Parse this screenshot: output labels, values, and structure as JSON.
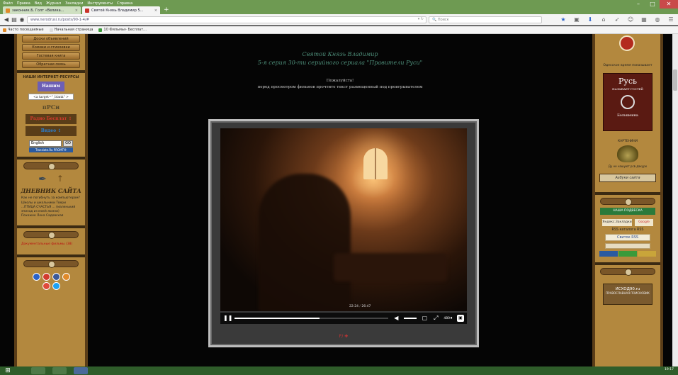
{
  "browser": {
    "menu": [
      "Файл",
      "Правка",
      "Вид",
      "Журнал",
      "Закладки",
      "Инструменты",
      "Справка"
    ],
    "tabs": [
      {
        "label": "законник.Б. Голт «Велика...",
        "favicon_color": "#e08a2a",
        "active": false
      },
      {
        "label": "Святой Князь Владимир 5...",
        "favicon_color": "#c9322a",
        "active": true
      }
    ],
    "new_tab_label": "+",
    "url": "www.nerodrusi.ru/posts/90-1-4/#",
    "search_placeholder": "Поиск",
    "bookmarks": [
      "Часто посещаемые",
      "Начальная страница",
      "10 Фильмы» Бесплат..."
    ],
    "window_controls": {
      "minimize": "–",
      "maximize": "□",
      "close": "✕"
    }
  },
  "left_sidebar": {
    "buttons": [
      "Доски объявлений",
      "Комики и стихоевки",
      "Гостевая книга",
      "Обратная связь"
    ],
    "resources_title": "НАШИ ИНТЕРНЕТ-РЕСУРСЫ",
    "logos": [
      {
        "text": "Нашим",
        "color": "#6d5fb5"
      },
      {
        "text": "<a target=\"_blank\" >",
        "color": "#ffffff"
      },
      {
        "text": "пРСи",
        "color": "#5a4a2a"
      },
      {
        "text": "Радио Бесплат ↕",
        "color": "#d23b2e"
      },
      {
        "text": "Видео ↕",
        "color": "#2b7fd0"
      }
    ],
    "translate_select": "English",
    "translate_button": "GO",
    "translate_credit": "Translate.Ru PROMT®",
    "diary_title": "ДНЕВНИК САЙТА",
    "diary_entries": [
      "Как не погибнуть за компьютером?",
      "Школы и школьники Твери",
      "...ПТИЦА СЧАСТЬЯ ... (маленький эпизод из моей жизни)",
      "Похожее Лена Садовская"
    ],
    "doc_link": "Документальные фильмы (38)"
  },
  "content": {
    "title": "Святой Князь Владимир",
    "subtitle": "5-я серия 30-ти серийного сериала \"Правители Руси\"",
    "notice_1": "Пожалуйста!",
    "notice_2": "перед просмотром фильмов прочтите текст размещенный под проигрывателем",
    "player": {
      "time_current": "22:24",
      "time_total": "26:47",
      "progress_fraction": 0.55,
      "quality": "480♦",
      "caption": "F/   ✚"
    }
  },
  "right_sidebar": {
    "top_text": "Одесское время показывает",
    "rus_banner_title": "Русь",
    "rus_banner_sub": "НАЗЫВАЕТ ГОСТЕЙ",
    "rus_banner_bottom": "Большеина",
    "pot_label": "КАРТЕНИНИ",
    "pot_caption": "Ду не нашуют рсв дакурк",
    "alphabet_banner": "Азбуки сайта",
    "badges": [
      {
        "text": "НАША ПОДВЕСКА",
        "color": "#2a7a3a"
      },
      {
        "text": "Яндекс.Закладки",
        "color": "#7a6a30"
      }
    ],
    "google_label": "Google",
    "rss_label": "RSS каталога RSS",
    "neon_label": "Свиток RSS",
    "info_plate_title": "ИСХОД90.ru",
    "info_plate_sub": "ПРАВОСЛАВНАЯ ПОИСКОВИК"
  },
  "taskbar": {
    "start_icon": "windows-icon",
    "clock": "19:17"
  }
}
